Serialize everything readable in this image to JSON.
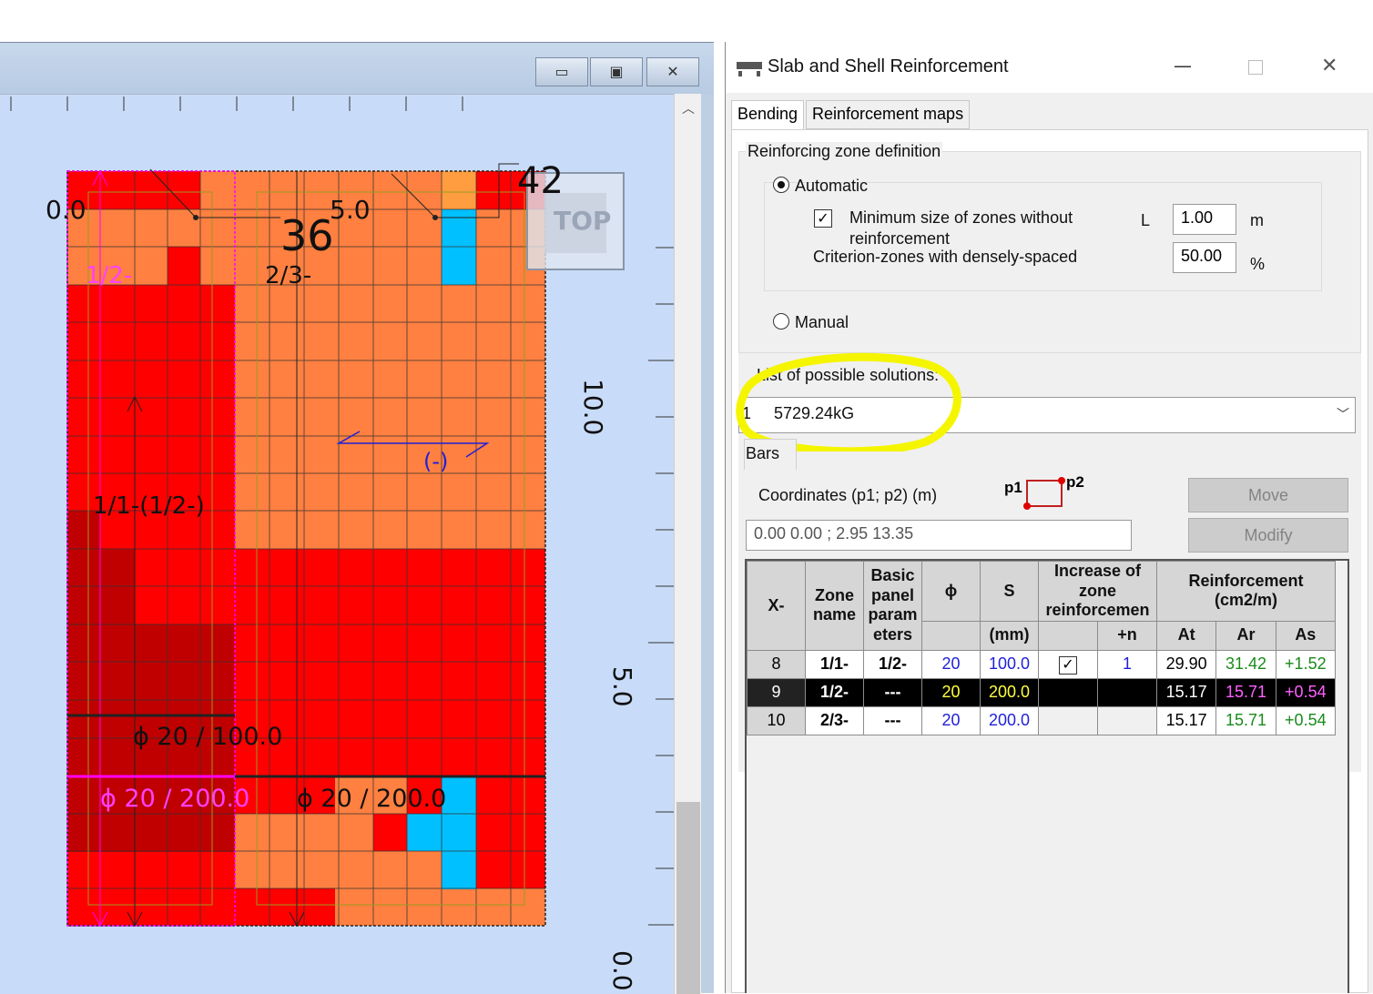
{
  "left_window": {
    "buttons": {
      "minimize": "▭",
      "restore": "▣",
      "close": "✕"
    },
    "ruler_x": [
      "0.0",
      "5.0"
    ],
    "ruler_y": [
      "10.0",
      "5.0",
      "0.0"
    ],
    "labels": {
      "num_36": "36",
      "num_42": "42",
      "zone_12": "1/2-",
      "zone_23": "2/3-",
      "zone_11": "1/1-(1/2-)",
      "minus": "(-)",
      "bar_1": "ϕ 20 / 100.0",
      "bar_2": "ϕ 20 / 200.0",
      "bar_3": "ϕ 20 / 200.0",
      "top_cube": "TOP"
    },
    "colors": {
      "orange": "#ff8040",
      "red": "#ff0000",
      "darkred": "#c00000",
      "cyan": "#00c0ff",
      "magenta": "#ff00ff",
      "canvas": "#c8dcf9"
    }
  },
  "dialog": {
    "title": "Slab and Shell Reinforcement",
    "tabs": [
      "Bending",
      "Reinforcement maps"
    ],
    "zone_group_title": "Reinforcing zone definition",
    "automatic_label": "Automatic",
    "min_size_label_1": "Minimum size of zones without",
    "min_size_label_2": "reinforcement",
    "L_label": "L",
    "L_value": "1.00",
    "L_unit": "m",
    "criterion_label": "Criterion-zones with densely-spaced",
    "criterion_value": "50.00",
    "criterion_unit": "%",
    "manual_label": "Manual",
    "solutions_label": "List of possible solutions:",
    "solution_index": "1",
    "solution_value": "5729.24kG",
    "bars_tab": "Bars",
    "coords_label": "Coordinates (p1; p2) (m)",
    "p1": "p1",
    "p2": "p2",
    "coords_value": "0.00  0.00  ;  2.95  13.35",
    "move_button": "Move",
    "modify_button": "Modify"
  },
  "table": {
    "headers": {
      "x": "X-",
      "zone": "Zone name",
      "basic": "Basic panel param eters",
      "phi": "ϕ",
      "s": "S",
      "s_unit": "(mm)",
      "increase": "Increase of zone reinforcemen",
      "plus_n": "+n",
      "reinf": "Reinforcement (cm2/m)",
      "at": "At",
      "ar": "Ar",
      "as": "As"
    },
    "rows": [
      {
        "x": "8",
        "zone": "1/1-",
        "basic": "1/2-",
        "phi": "20",
        "s": "100.0",
        "check": "✓",
        "n": "1",
        "at": "29.90",
        "ar": "31.42",
        "as": "+1.52"
      },
      {
        "x": "9",
        "zone": "1/2-",
        "basic": "---",
        "phi": "20",
        "s": "200.0",
        "check": "",
        "n": "",
        "at": "15.17",
        "ar": "15.71",
        "as": "+0.54"
      },
      {
        "x": "10",
        "zone": "2/3-",
        "basic": "---",
        "phi": "20",
        "s": "200.0",
        "check": "",
        "n": "",
        "at": "15.17",
        "ar": "15.71",
        "as": "+0.54"
      }
    ]
  }
}
